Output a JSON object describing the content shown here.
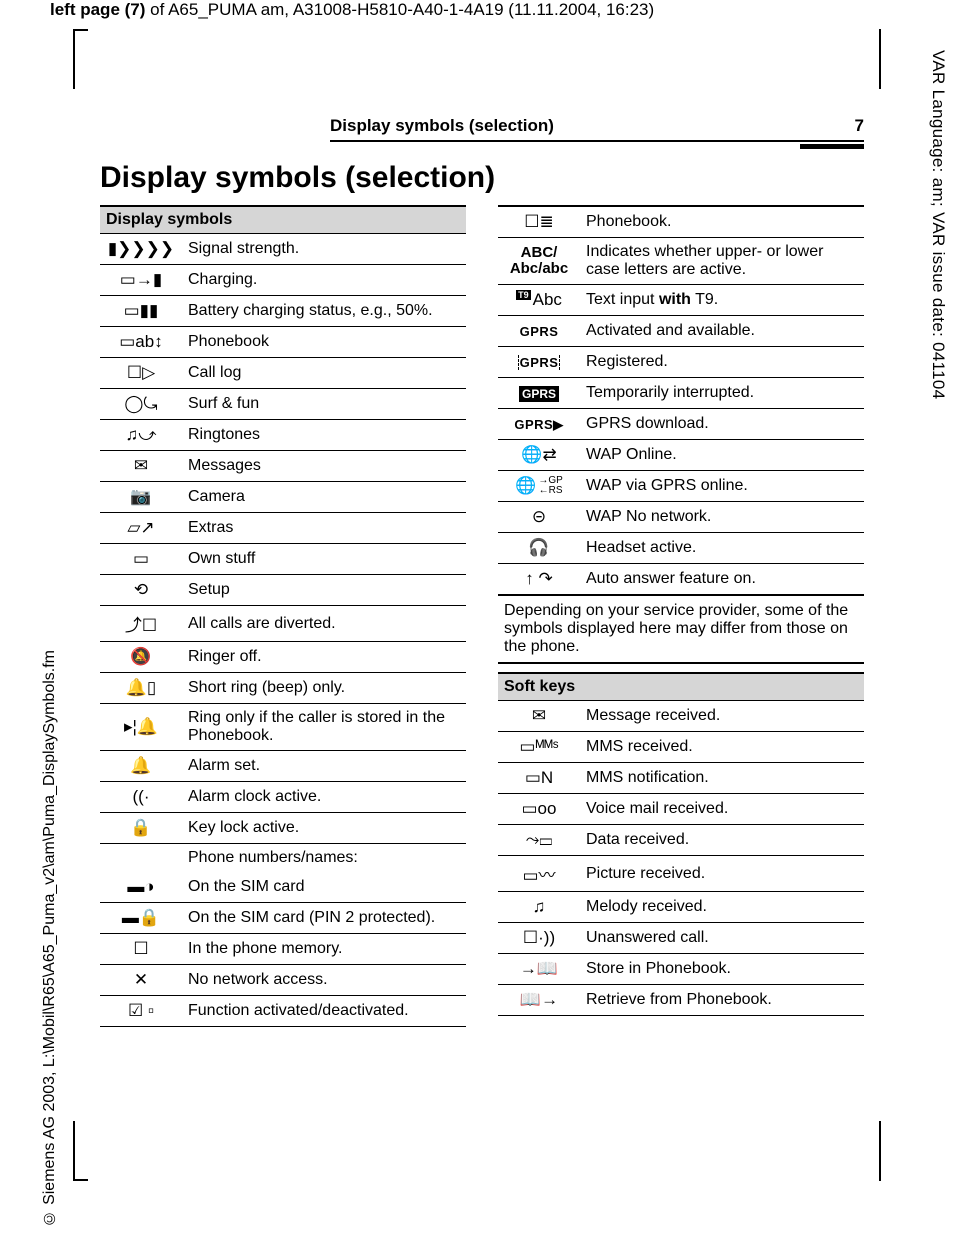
{
  "meta": {
    "header_prefix": "left page (7)",
    "header_rest": " of A65_PUMA am, A31008-H5810-A40-1-4A19 (11.11.2004, 16:23)",
    "side_right": "VAR Language: am; VAR issue date: 041104",
    "side_left": "© Siemens AG 2003, L:\\Mobil\\R65\\A65_Puma_v2\\am\\Puma_DisplaySymbols.fm",
    "running_title": "Display symbols (selection)",
    "running_page": "7"
  },
  "title": "Display symbols (selection)",
  "left_table": {
    "header": "Display symbols",
    "rows": [
      {
        "icon": "▮❯❯❯❯",
        "desc": "Signal strength."
      },
      {
        "icon": "▭→▮",
        "desc": "Charging."
      },
      {
        "icon": "▭▮▮",
        "desc": "Battery charging status, e.g., 50%."
      },
      {
        "icon": "▭ab↕",
        "desc": "Phonebook"
      },
      {
        "icon": "☐▷",
        "desc": "Call log"
      },
      {
        "icon": "◯⤿",
        "desc": "Surf & fun"
      },
      {
        "icon": "♫⤻",
        "desc": "Ringtones"
      },
      {
        "icon": "✉",
        "desc": "Messages"
      },
      {
        "icon": "📷",
        "desc": "Camera"
      },
      {
        "icon": "▱↗",
        "desc": "Extras"
      },
      {
        "icon": "▭",
        "desc": "Own stuff"
      },
      {
        "icon": "⟲",
        "desc": "Setup"
      },
      {
        "icon": "⤴☐",
        "desc": "All calls are diverted."
      },
      {
        "icon": "🔕",
        "desc": "Ringer off."
      },
      {
        "icon": "🔔▯",
        "desc": "Short ring (beep) only."
      },
      {
        "icon": "▸¦🔔",
        "desc": "Ring only if the caller is stored in the Phonebook."
      },
      {
        "icon": "🔔",
        "desc": "Alarm set."
      },
      {
        "icon": "((·",
        "desc": "Alarm clock active."
      },
      {
        "icon": "🔒",
        "desc": "Key lock active."
      },
      {
        "icon": "",
        "desc": "Phone numbers/names:",
        "noborder": true
      },
      {
        "icon": "▬◑",
        "desc": "On the SIM card"
      },
      {
        "icon": "▬🔒",
        "desc": "On the SIM card (PIN 2 protected)."
      },
      {
        "icon": "☐",
        "desc": "In the phone memory."
      },
      {
        "icon": "✕",
        "desc": "No network access."
      },
      {
        "icon": "☑ ▫",
        "desc": "Function activated/deactivated."
      }
    ]
  },
  "right_table_a": {
    "rows": [
      {
        "icon_html": "plain",
        "icon": "☐≣",
        "desc": "Phonebook."
      },
      {
        "icon_html": "abc",
        "icon": "ABC/ Abc/abc",
        "desc": "Indicates whether upper- or lower case letters are active."
      },
      {
        "icon_html": "t9",
        "icon": "Abc",
        "desc_pre": "Text input ",
        "desc_bold": "with",
        "desc_post": " T9."
      },
      {
        "icon_html": "gprs",
        "icon": "GPRS",
        "desc": "Activated and available."
      },
      {
        "icon_html": "gprsdash",
        "icon": "GPRS",
        "desc": "Registered."
      },
      {
        "icon_html": "gprsbox",
        "icon": "GPRS",
        "desc": "Temporarily interrupted."
      },
      {
        "icon_html": "gprsplay",
        "icon": "GPRS▶",
        "desc": "GPRS download."
      },
      {
        "icon_html": "plain",
        "icon": "🌐⇄",
        "desc": "WAP Online."
      },
      {
        "icon_html": "wapgp",
        "icon": "🌐",
        "sub": "→GP\n←RS",
        "desc": "WAP via GPRS online."
      },
      {
        "icon_html": "plain",
        "icon": "⊝",
        "desc": "WAP No network."
      },
      {
        "icon_html": "plain",
        "icon": "🎧",
        "desc": "Headset active."
      },
      {
        "icon_html": "plain",
        "icon": "↑ ↷",
        "desc": "Auto answer feature on."
      }
    ]
  },
  "note": "Depending on your service provider, some of the symbols displayed here may differ from those on the phone.",
  "right_table_b": {
    "header": "Soft keys",
    "rows": [
      {
        "icon": "✉",
        "desc": "Message received."
      },
      {
        "icon": "▭ᴹᴹˢ",
        "desc": "MMS received."
      },
      {
        "icon": "▭N",
        "desc": "MMS notification."
      },
      {
        "icon": "▭oo",
        "desc": "Voice mail received."
      },
      {
        "icon": "⤳▭",
        "desc": "Data received."
      },
      {
        "icon": "▭〰",
        "desc": "Picture received."
      },
      {
        "icon": "♫",
        "desc": "Melody received."
      },
      {
        "icon": "☐·))",
        "desc": "Unanswered call."
      },
      {
        "icon": "→📖",
        "desc": "Store in Phonebook."
      },
      {
        "icon": "📖→",
        "desc": "Retrieve from Phonebook."
      }
    ]
  }
}
